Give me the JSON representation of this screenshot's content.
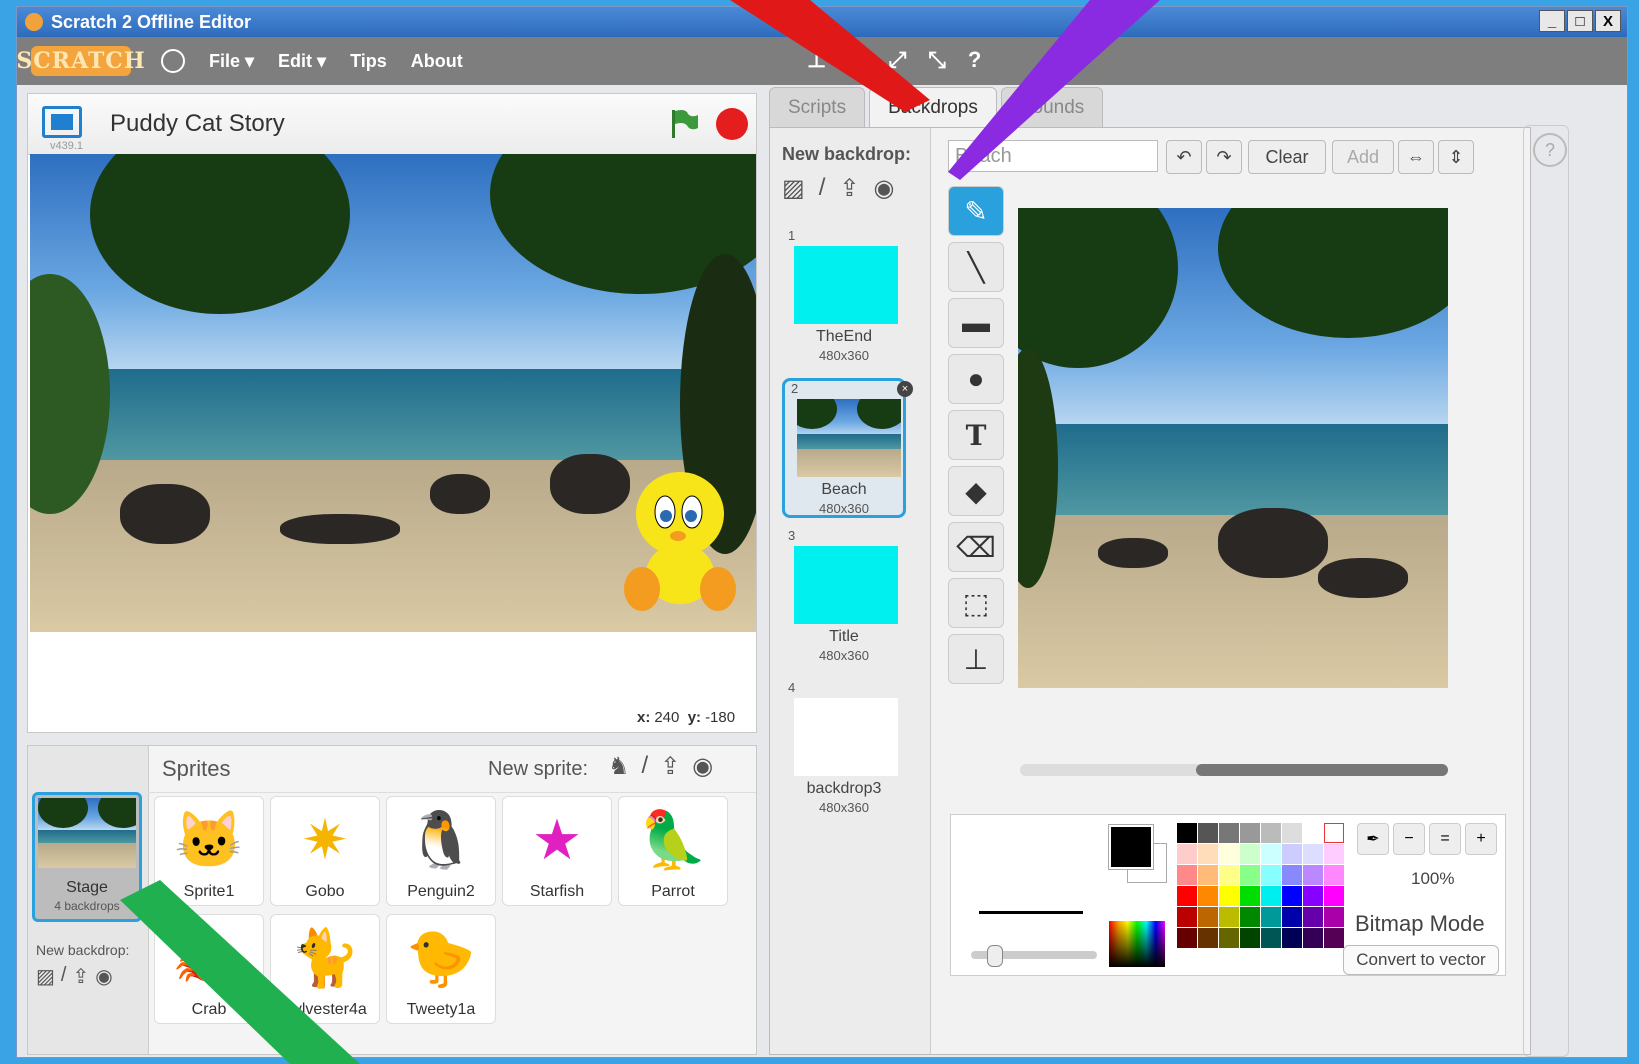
{
  "window": {
    "title": "Scratch 2 Offline Editor",
    "min": "_",
    "max": "□",
    "close": "X"
  },
  "menu": {
    "logo": "SCRATCH",
    "file": "File ▾",
    "edit": "Edit ▾",
    "tips": "Tips",
    "about": "About"
  },
  "menu_tools": [
    "stamp-icon",
    "grow-icon",
    "expand-icon",
    "shrink-icon",
    "help-icon"
  ],
  "stage": {
    "title": "Puddy Cat Story",
    "version": "v439.1",
    "x_label": "x:",
    "x_value": "240",
    "y_label": "y:",
    "y_value": "-180"
  },
  "sprites_panel": {
    "header": "Sprites",
    "new_sprite": "New sprite:",
    "stage_label": "Stage",
    "stage_sub": "4 backdrops",
    "new_backdrop": "New backdrop:"
  },
  "sprites": [
    "Sprite1",
    "Gobo",
    "Penguin2",
    "Starfish",
    "Parrot",
    "Crab",
    "Sylvester4a",
    "Tweety1a"
  ],
  "tabs": [
    "Scripts",
    "Backdrops",
    "Sounds"
  ],
  "backdrops_panel": {
    "new_backdrop": "New backdrop:"
  },
  "backdrops": [
    {
      "num": "1",
      "name": "TheEnd",
      "size": "480x360"
    },
    {
      "num": "2",
      "name": "Beach",
      "size": "480x360"
    },
    {
      "num": "3",
      "name": "Title",
      "size": "480x360"
    },
    {
      "num": "4",
      "name": "backdrop3",
      "size": "480x360"
    }
  ],
  "paint": {
    "costume_name": "Beach",
    "clear": "Clear",
    "add": "Add",
    "zoom": "100%",
    "mode": "Bitmap Mode",
    "convert": "Convert to vector"
  },
  "colors": {
    "accent": "#2aa0dc",
    "menubar": "#7e7e7e",
    "titlebar": "#2f6bbd"
  }
}
